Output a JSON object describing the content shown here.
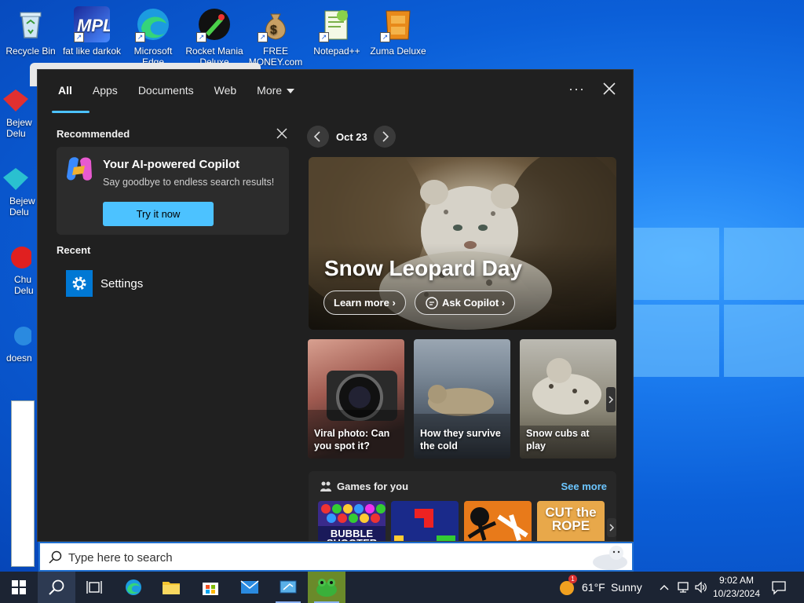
{
  "desktop": {
    "top_icons": [
      {
        "label": "Recycle Bin"
      },
      {
        "label": "fat like darkok"
      },
      {
        "label": "Microsoft Edge"
      },
      {
        "label": "Rocket Mania Deluxe"
      },
      {
        "label": "FREE MONEY.com"
      },
      {
        "label": "Notepad++"
      },
      {
        "label": "Zuma Deluxe"
      }
    ],
    "left_icons": [
      {
        "label": "Bejew Delu"
      },
      {
        "label": "Bejew Delu"
      },
      {
        "label": "Chu Delu"
      },
      {
        "label": "doesn"
      }
    ]
  },
  "search_panel": {
    "tabs": [
      {
        "label": "All"
      },
      {
        "label": "Apps"
      },
      {
        "label": "Documents"
      },
      {
        "label": "Web"
      },
      {
        "label": "More"
      }
    ],
    "more_options": "···",
    "recommended": {
      "title": "Recommended",
      "card_title": "Your AI-powered Copilot",
      "card_subtitle": "Say goodbye to endless search results!",
      "button": "Try it now"
    },
    "recent": {
      "title": "Recent",
      "items": [
        {
          "label": "Settings"
        }
      ]
    },
    "highlights": {
      "date": "Oct 23",
      "hero_title": "Snow Leopard Day",
      "learn_more": "Learn more",
      "ask_copilot": "Ask Copilot",
      "cards": [
        {
          "caption": "Viral photo: Can you spot it?"
        },
        {
          "caption": "How they survive the cold"
        },
        {
          "caption": "Snow cubs at play"
        }
      ]
    },
    "games": {
      "title": "Games for you",
      "see_more": "See more",
      "tiles": [
        {
          "label": "BUBBLE SHOOTER"
        },
        {
          "label": ""
        },
        {
          "label": ""
        },
        {
          "label": "CUT the ROPE"
        }
      ]
    }
  },
  "search_bar": {
    "placeholder": "Type here to search"
  },
  "taskbar": {
    "weather_temp": "61°F",
    "weather_text": "Sunny",
    "weather_badge": "1",
    "time": "9:02 AM",
    "date": "10/23/2024"
  },
  "colors": {
    "accent": "#4cc2ff",
    "panel_bg": "#202020",
    "taskbar_bg": "#1c2433"
  }
}
